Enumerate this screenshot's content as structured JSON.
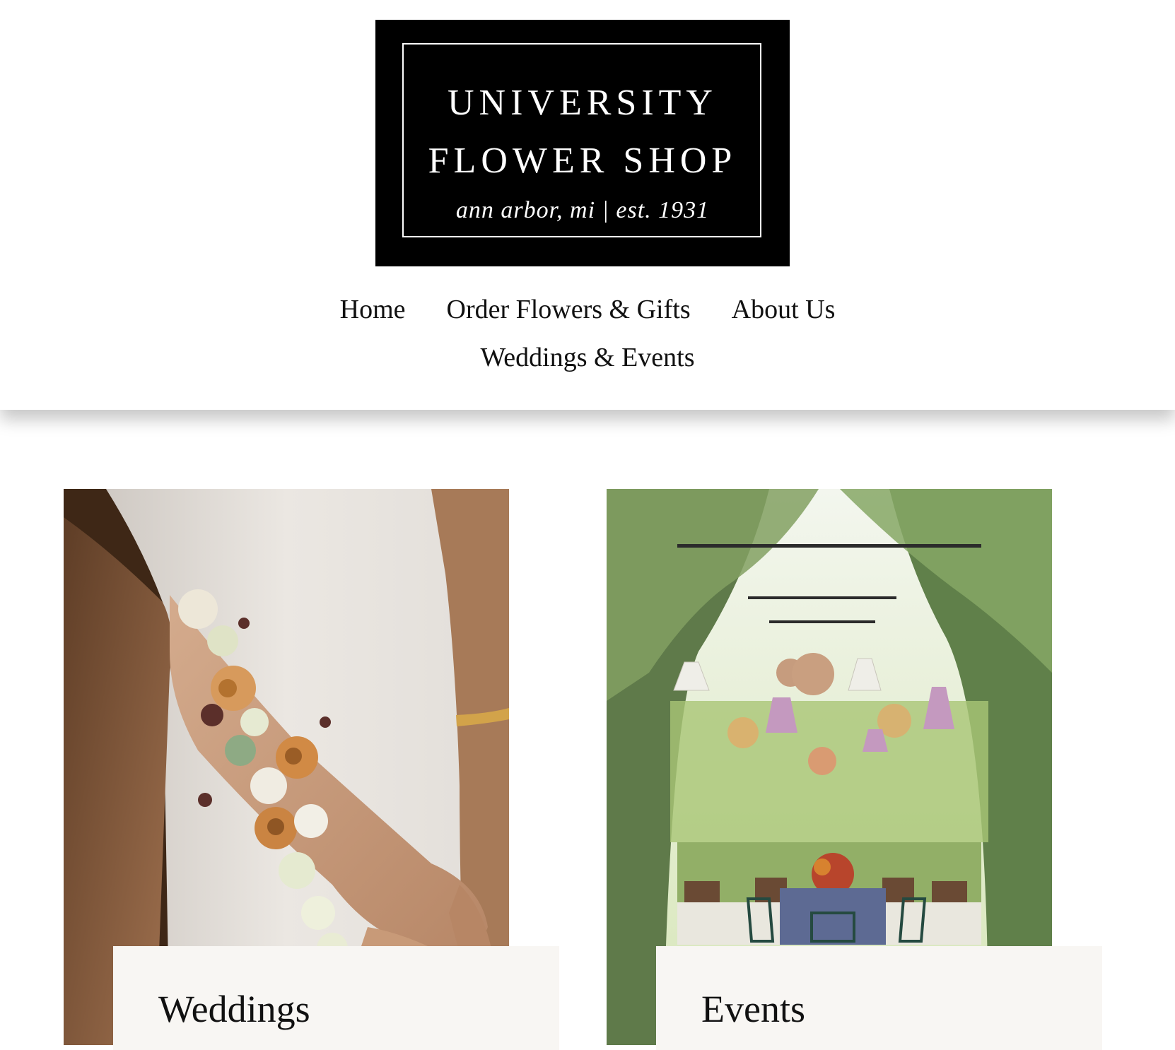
{
  "logo": {
    "line1": "UNIVERSITY",
    "line2": "FLOWER SHOP",
    "tagline": "ann arbor, mi  |  est. 1931"
  },
  "nav": {
    "items": [
      {
        "label": "Home"
      },
      {
        "label": "Order Flowers & Gifts"
      },
      {
        "label": "About Us"
      },
      {
        "label": "Weddings & Events"
      }
    ]
  },
  "cards": [
    {
      "title": "Weddings",
      "image": "wrist-corsage-photo"
    },
    {
      "title": "Events",
      "image": "garden-lanterns-photo"
    }
  ],
  "colors": {
    "logo_bg": "#000000",
    "logo_text": "#ffffff",
    "label_box": "#f8f6f3",
    "page_bg": "#ffffff"
  }
}
